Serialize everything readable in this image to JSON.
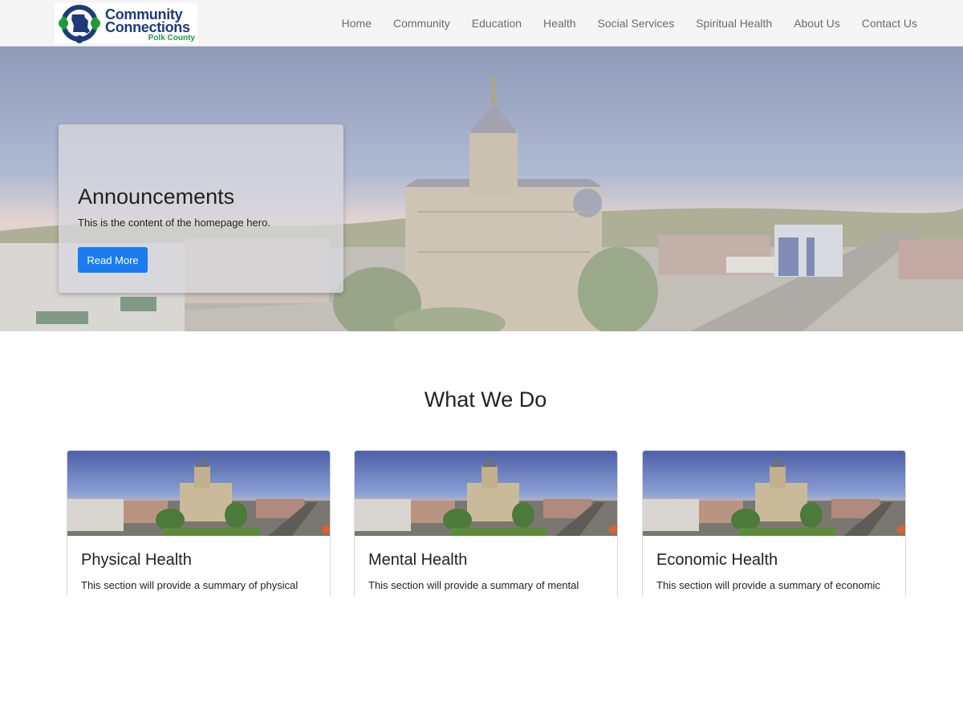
{
  "brand": {
    "line1": "Community",
    "line2": "Connections",
    "line3": "Polk County",
    "colors": {
      "blue": "#1e3a7b",
      "green": "#1f9a3b"
    }
  },
  "nav": {
    "items": [
      {
        "label": "Home"
      },
      {
        "label": "Community"
      },
      {
        "label": "Education"
      },
      {
        "label": "Health"
      },
      {
        "label": "Social Services"
      },
      {
        "label": "Spiritual Health"
      },
      {
        "label": "About Us"
      },
      {
        "label": "Contact Us"
      }
    ]
  },
  "hero": {
    "title": "Announcements",
    "text": "This is the content of the homepage hero.",
    "button_label": "Read More",
    "button_color": "#1a7cf0"
  },
  "section": {
    "title": "What We Do",
    "cards": [
      {
        "title": "Physical Health",
        "text": "This section will provide a summary of physical health and what services are offered."
      },
      {
        "title": "Mental Health",
        "text": "This section will provide a summary of mental health and what services are offered."
      },
      {
        "title": "Economic Health",
        "text": "This section will provide a summary of economic health and what services are offered."
      }
    ]
  }
}
